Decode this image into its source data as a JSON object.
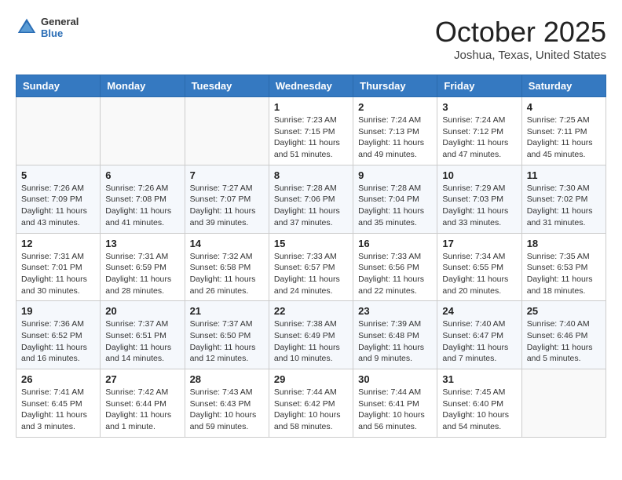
{
  "logo": {
    "general": "General",
    "blue": "Blue"
  },
  "header": {
    "month": "October 2025",
    "location": "Joshua, Texas, United States"
  },
  "weekdays": [
    "Sunday",
    "Monday",
    "Tuesday",
    "Wednesday",
    "Thursday",
    "Friday",
    "Saturday"
  ],
  "weeks": [
    [
      {
        "day": "",
        "info": ""
      },
      {
        "day": "",
        "info": ""
      },
      {
        "day": "",
        "info": ""
      },
      {
        "day": "1",
        "info": "Sunrise: 7:23 AM\nSunset: 7:15 PM\nDaylight: 11 hours\nand 51 minutes."
      },
      {
        "day": "2",
        "info": "Sunrise: 7:24 AM\nSunset: 7:13 PM\nDaylight: 11 hours\nand 49 minutes."
      },
      {
        "day": "3",
        "info": "Sunrise: 7:24 AM\nSunset: 7:12 PM\nDaylight: 11 hours\nand 47 minutes."
      },
      {
        "day": "4",
        "info": "Sunrise: 7:25 AM\nSunset: 7:11 PM\nDaylight: 11 hours\nand 45 minutes."
      }
    ],
    [
      {
        "day": "5",
        "info": "Sunrise: 7:26 AM\nSunset: 7:09 PM\nDaylight: 11 hours\nand 43 minutes."
      },
      {
        "day": "6",
        "info": "Sunrise: 7:26 AM\nSunset: 7:08 PM\nDaylight: 11 hours\nand 41 minutes."
      },
      {
        "day": "7",
        "info": "Sunrise: 7:27 AM\nSunset: 7:07 PM\nDaylight: 11 hours\nand 39 minutes."
      },
      {
        "day": "8",
        "info": "Sunrise: 7:28 AM\nSunset: 7:06 PM\nDaylight: 11 hours\nand 37 minutes."
      },
      {
        "day": "9",
        "info": "Sunrise: 7:28 AM\nSunset: 7:04 PM\nDaylight: 11 hours\nand 35 minutes."
      },
      {
        "day": "10",
        "info": "Sunrise: 7:29 AM\nSunset: 7:03 PM\nDaylight: 11 hours\nand 33 minutes."
      },
      {
        "day": "11",
        "info": "Sunrise: 7:30 AM\nSunset: 7:02 PM\nDaylight: 11 hours\nand 31 minutes."
      }
    ],
    [
      {
        "day": "12",
        "info": "Sunrise: 7:31 AM\nSunset: 7:01 PM\nDaylight: 11 hours\nand 30 minutes."
      },
      {
        "day": "13",
        "info": "Sunrise: 7:31 AM\nSunset: 6:59 PM\nDaylight: 11 hours\nand 28 minutes."
      },
      {
        "day": "14",
        "info": "Sunrise: 7:32 AM\nSunset: 6:58 PM\nDaylight: 11 hours\nand 26 minutes."
      },
      {
        "day": "15",
        "info": "Sunrise: 7:33 AM\nSunset: 6:57 PM\nDaylight: 11 hours\nand 24 minutes."
      },
      {
        "day": "16",
        "info": "Sunrise: 7:33 AM\nSunset: 6:56 PM\nDaylight: 11 hours\nand 22 minutes."
      },
      {
        "day": "17",
        "info": "Sunrise: 7:34 AM\nSunset: 6:55 PM\nDaylight: 11 hours\nand 20 minutes."
      },
      {
        "day": "18",
        "info": "Sunrise: 7:35 AM\nSunset: 6:53 PM\nDaylight: 11 hours\nand 18 minutes."
      }
    ],
    [
      {
        "day": "19",
        "info": "Sunrise: 7:36 AM\nSunset: 6:52 PM\nDaylight: 11 hours\nand 16 minutes."
      },
      {
        "day": "20",
        "info": "Sunrise: 7:37 AM\nSunset: 6:51 PM\nDaylight: 11 hours\nand 14 minutes."
      },
      {
        "day": "21",
        "info": "Sunrise: 7:37 AM\nSunset: 6:50 PM\nDaylight: 11 hours\nand 12 minutes."
      },
      {
        "day": "22",
        "info": "Sunrise: 7:38 AM\nSunset: 6:49 PM\nDaylight: 11 hours\nand 10 minutes."
      },
      {
        "day": "23",
        "info": "Sunrise: 7:39 AM\nSunset: 6:48 PM\nDaylight: 11 hours\nand 9 minutes."
      },
      {
        "day": "24",
        "info": "Sunrise: 7:40 AM\nSunset: 6:47 PM\nDaylight: 11 hours\nand 7 minutes."
      },
      {
        "day": "25",
        "info": "Sunrise: 7:40 AM\nSunset: 6:46 PM\nDaylight: 11 hours\nand 5 minutes."
      }
    ],
    [
      {
        "day": "26",
        "info": "Sunrise: 7:41 AM\nSunset: 6:45 PM\nDaylight: 11 hours\nand 3 minutes."
      },
      {
        "day": "27",
        "info": "Sunrise: 7:42 AM\nSunset: 6:44 PM\nDaylight: 11 hours\nand 1 minute."
      },
      {
        "day": "28",
        "info": "Sunrise: 7:43 AM\nSunset: 6:43 PM\nDaylight: 10 hours\nand 59 minutes."
      },
      {
        "day": "29",
        "info": "Sunrise: 7:44 AM\nSunset: 6:42 PM\nDaylight: 10 hours\nand 58 minutes."
      },
      {
        "day": "30",
        "info": "Sunrise: 7:44 AM\nSunset: 6:41 PM\nDaylight: 10 hours\nand 56 minutes."
      },
      {
        "day": "31",
        "info": "Sunrise: 7:45 AM\nSunset: 6:40 PM\nDaylight: 10 hours\nand 54 minutes."
      },
      {
        "day": "",
        "info": ""
      }
    ]
  ]
}
